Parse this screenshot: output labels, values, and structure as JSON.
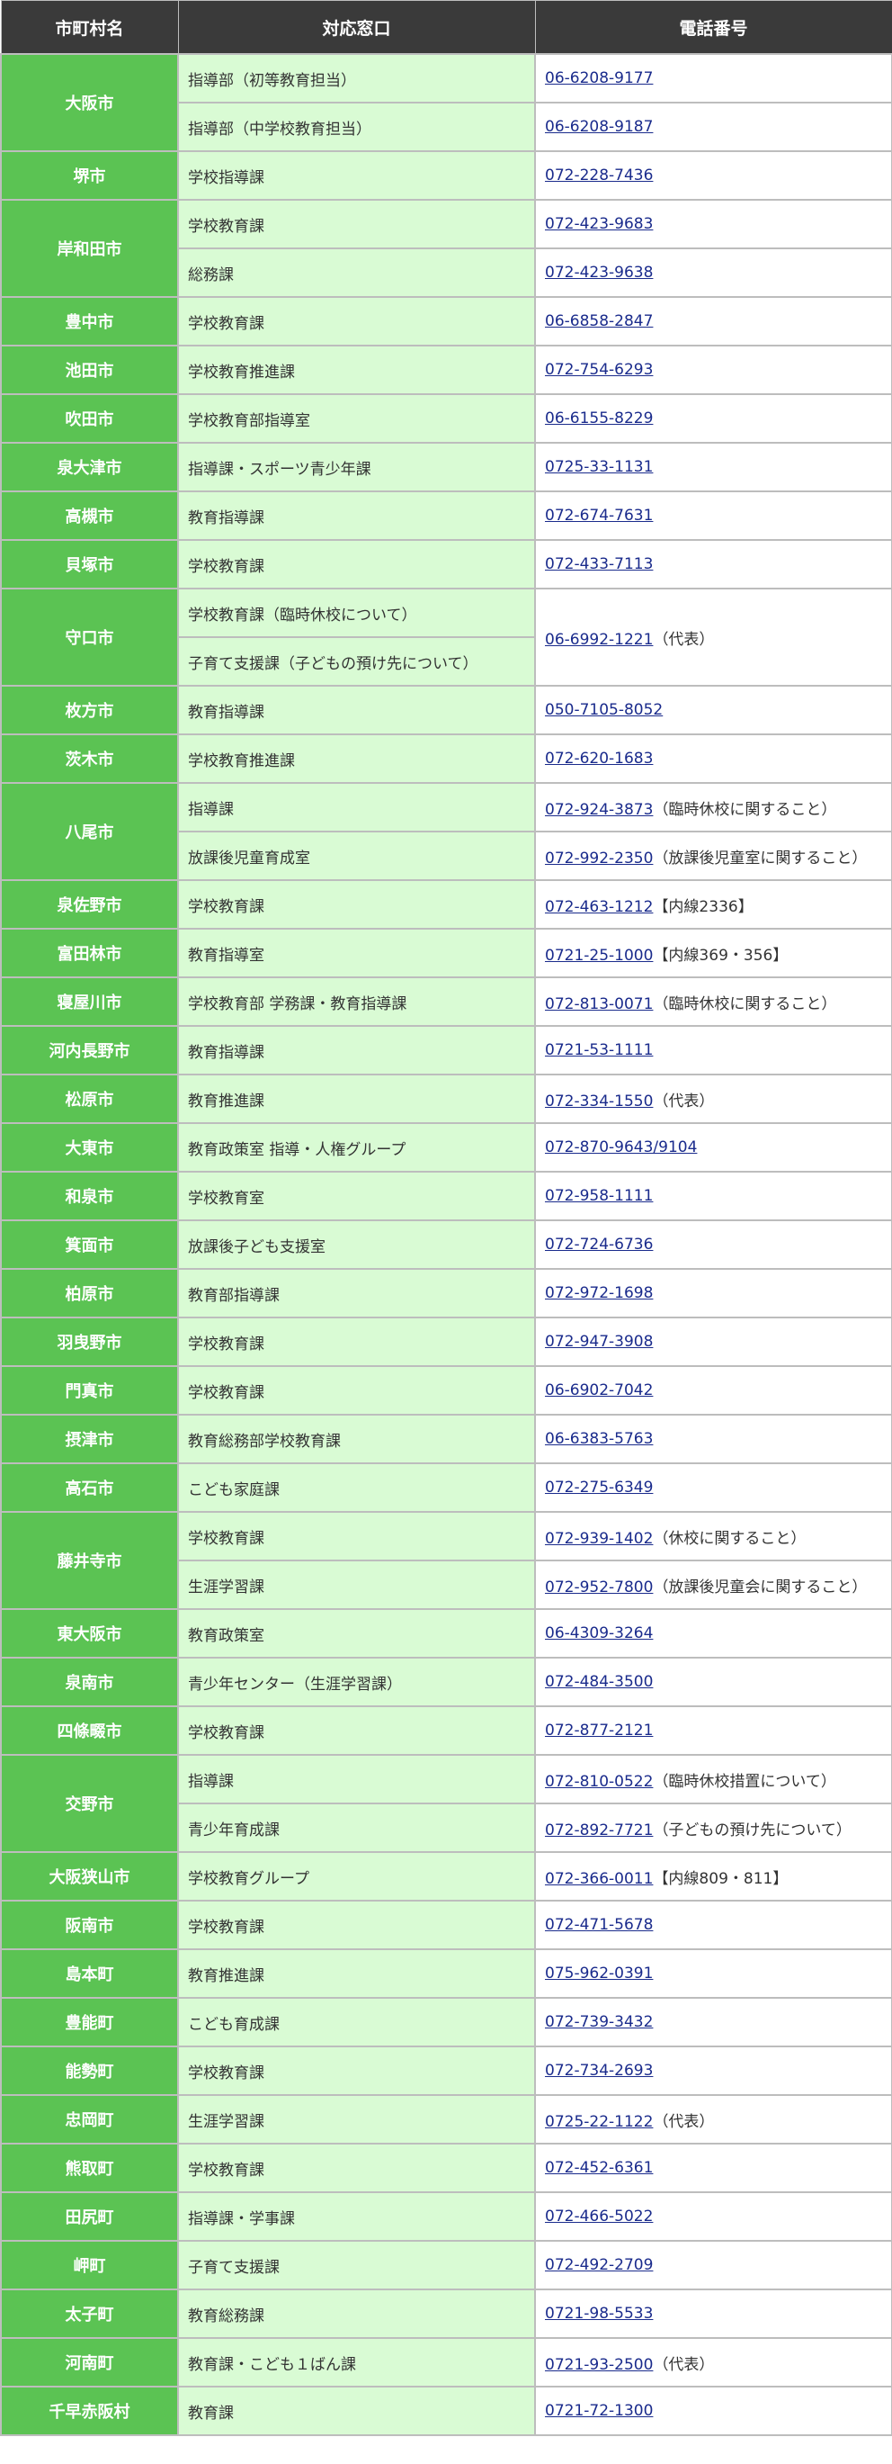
{
  "headers": [
    "市町村名",
    "対応窓口",
    "電話番号"
  ],
  "rows": [
    {
      "city": "大阪市",
      "contacts": [
        {
          "dept": "指導部（初等教育担当）",
          "phone": "06-6208-9177",
          "note": ""
        },
        {
          "dept": "指導部（中学校教育担当）",
          "phone": "06-6208-9187",
          "note": ""
        }
      ]
    },
    {
      "city": "堺市",
      "contacts": [
        {
          "dept": "学校指導課",
          "phone": "072-228-7436",
          "note": ""
        }
      ]
    },
    {
      "city": "岸和田市",
      "contacts": [
        {
          "dept": "学校教育課",
          "phone": "072-423-9683",
          "note": ""
        },
        {
          "dept": "総務課",
          "phone": "072-423-9638",
          "note": ""
        }
      ]
    },
    {
      "city": "豊中市",
      "contacts": [
        {
          "dept": "学校教育課",
          "phone": "06-6858-2847",
          "note": ""
        }
      ]
    },
    {
      "city": "池田市",
      "contacts": [
        {
          "dept": "学校教育推進課",
          "phone": "072-754-6293",
          "note": ""
        }
      ]
    },
    {
      "city": "吹田市",
      "contacts": [
        {
          "dept": "学校教育部指導室",
          "phone": "06-6155-8229",
          "note": ""
        }
      ]
    },
    {
      "city": "泉大津市",
      "contacts": [
        {
          "dept": "指導課・スポーツ青少年課",
          "phone": "0725-33-1131",
          "note": ""
        }
      ]
    },
    {
      "city": "高槻市",
      "contacts": [
        {
          "dept": "教育指導課",
          "phone": "072-674-7631",
          "note": ""
        }
      ]
    },
    {
      "city": "貝塚市",
      "contacts": [
        {
          "dept": "学校教育課",
          "phone": "072-433-7113",
          "note": ""
        }
      ]
    },
    {
      "city": "守口市",
      "contacts": [
        {
          "dept": "学校教育課（臨時休校について）",
          "phone": "06-6992-1221",
          "note": "（代表）"
        },
        {
          "dept": "子育て支援課（子どもの預け先について）",
          "phone": null,
          "note": null
        }
      ],
      "merged_phone": true
    },
    {
      "city": "枚方市",
      "contacts": [
        {
          "dept": "教育指導課",
          "phone": "050-7105-8052",
          "note": ""
        }
      ]
    },
    {
      "city": "茨木市",
      "contacts": [
        {
          "dept": "学校教育推進課",
          "phone": "072-620-1683",
          "note": ""
        }
      ]
    },
    {
      "city": "八尾市",
      "contacts": [
        {
          "dept": "指導課",
          "phone": "072-924-3873",
          "note": "（臨時休校に関すること）"
        },
        {
          "dept": "放課後児童育成室",
          "phone": "072-992-2350",
          "note": "（放課後児童室に関すること）"
        }
      ]
    },
    {
      "city": "泉佐野市",
      "contacts": [
        {
          "dept": "学校教育課",
          "phone": "072-463-1212",
          "note": "【内線2336】"
        }
      ]
    },
    {
      "city": "富田林市",
      "contacts": [
        {
          "dept": "教育指導室",
          "phone": "0721-25-1000",
          "note": "【内線369・356】"
        }
      ]
    },
    {
      "city": "寝屋川市",
      "contacts": [
        {
          "dept": "学校教育部 学務課・教育指導課",
          "phone": "072-813-0071",
          "note": "（臨時休校に関すること）"
        }
      ]
    },
    {
      "city": "河内長野市",
      "contacts": [
        {
          "dept": "教育指導課",
          "phone": "0721-53-1111",
          "note": ""
        }
      ]
    },
    {
      "city": "松原市",
      "contacts": [
        {
          "dept": "教育推進課",
          "phone": "072-334-1550",
          "note": "（代表）"
        }
      ]
    },
    {
      "city": "大東市",
      "contacts": [
        {
          "dept": "教育政策室 指導・人権グループ",
          "phone": "072-870-9643/9104",
          "note": ""
        }
      ]
    },
    {
      "city": "和泉市",
      "contacts": [
        {
          "dept": "学校教育室",
          "phone": "072-958-1111",
          "note": ""
        }
      ]
    },
    {
      "city": "箕面市",
      "contacts": [
        {
          "dept": "放課後子ども支援室",
          "phone": "072-724-6736",
          "note": ""
        }
      ]
    },
    {
      "city": "柏原市",
      "contacts": [
        {
          "dept": "教育部指導課",
          "phone": "072-972-1698",
          "note": ""
        }
      ]
    },
    {
      "city": "羽曳野市",
      "contacts": [
        {
          "dept": "学校教育課",
          "phone": "072-947-3908",
          "note": ""
        }
      ]
    },
    {
      "city": "門真市",
      "contacts": [
        {
          "dept": "学校教育課",
          "phone": "06-6902-7042",
          "note": ""
        }
      ]
    },
    {
      "city": "摂津市",
      "contacts": [
        {
          "dept": "教育総務部学校教育課",
          "phone": "06-6383-5763",
          "note": ""
        }
      ]
    },
    {
      "city": "高石市",
      "contacts": [
        {
          "dept": "こども家庭課",
          "phone": "072-275-6349",
          "note": ""
        }
      ]
    },
    {
      "city": "藤井寺市",
      "contacts": [
        {
          "dept": "学校教育課",
          "phone": "072-939-1402",
          "note": "（休校に関すること）"
        },
        {
          "dept": "生涯学習課",
          "phone": "072-952-7800",
          "note": "（放課後児童会に関すること）"
        }
      ]
    },
    {
      "city": "東大阪市",
      "contacts": [
        {
          "dept": "教育政策室",
          "phone": "06-4309-3264",
          "note": ""
        }
      ]
    },
    {
      "city": "泉南市",
      "contacts": [
        {
          "dept": "青少年センター（生涯学習課）",
          "phone": "072-484-3500",
          "note": ""
        }
      ]
    },
    {
      "city": "四條畷市",
      "contacts": [
        {
          "dept": "学校教育課",
          "phone": "072-877-2121",
          "note": ""
        }
      ]
    },
    {
      "city": "交野市",
      "contacts": [
        {
          "dept": "指導課",
          "phone": "072-810-0522",
          "note": "（臨時休校措置について）"
        },
        {
          "dept": "青少年育成課",
          "phone": "072-892-7721",
          "note": "（子どもの預け先について）"
        }
      ]
    },
    {
      "city": "大阪狭山市",
      "contacts": [
        {
          "dept": "学校教育グループ",
          "phone": "072-366-0011",
          "note": "【内線809・811】"
        }
      ]
    },
    {
      "city": "阪南市",
      "contacts": [
        {
          "dept": "学校教育課",
          "phone": "072-471-5678",
          "note": ""
        }
      ]
    },
    {
      "city": "島本町",
      "contacts": [
        {
          "dept": "教育推進課",
          "phone": "075-962-0391",
          "note": ""
        }
      ]
    },
    {
      "city": "豊能町",
      "contacts": [
        {
          "dept": "こども育成課",
          "phone": "072-739-3432",
          "note": ""
        }
      ]
    },
    {
      "city": "能勢町",
      "contacts": [
        {
          "dept": "学校教育課",
          "phone": "072-734-2693",
          "note": ""
        }
      ]
    },
    {
      "city": "忠岡町",
      "contacts": [
        {
          "dept": "生涯学習課",
          "phone": "0725-22-1122",
          "note": "（代表）"
        }
      ]
    },
    {
      "city": "熊取町",
      "contacts": [
        {
          "dept": "学校教育課",
          "phone": "072-452-6361",
          "note": ""
        }
      ]
    },
    {
      "city": "田尻町",
      "contacts": [
        {
          "dept": "指導課・学事課",
          "phone": "072-466-5022",
          "note": ""
        }
      ]
    },
    {
      "city": "岬町",
      "contacts": [
        {
          "dept": "子育て支援課",
          "phone": "072-492-2709",
          "note": ""
        }
      ]
    },
    {
      "city": "太子町",
      "contacts": [
        {
          "dept": "教育総務課",
          "phone": "0721-98-5533",
          "note": ""
        }
      ]
    },
    {
      "city": "河南町",
      "contacts": [
        {
          "dept": "教育課・こども１ばん課",
          "phone": "0721-93-2500",
          "note": "（代表）"
        }
      ]
    },
    {
      "city": "千早赤阪村",
      "contacts": [
        {
          "dept": "教育課",
          "phone": "0721-72-1300",
          "note": ""
        }
      ]
    }
  ]
}
